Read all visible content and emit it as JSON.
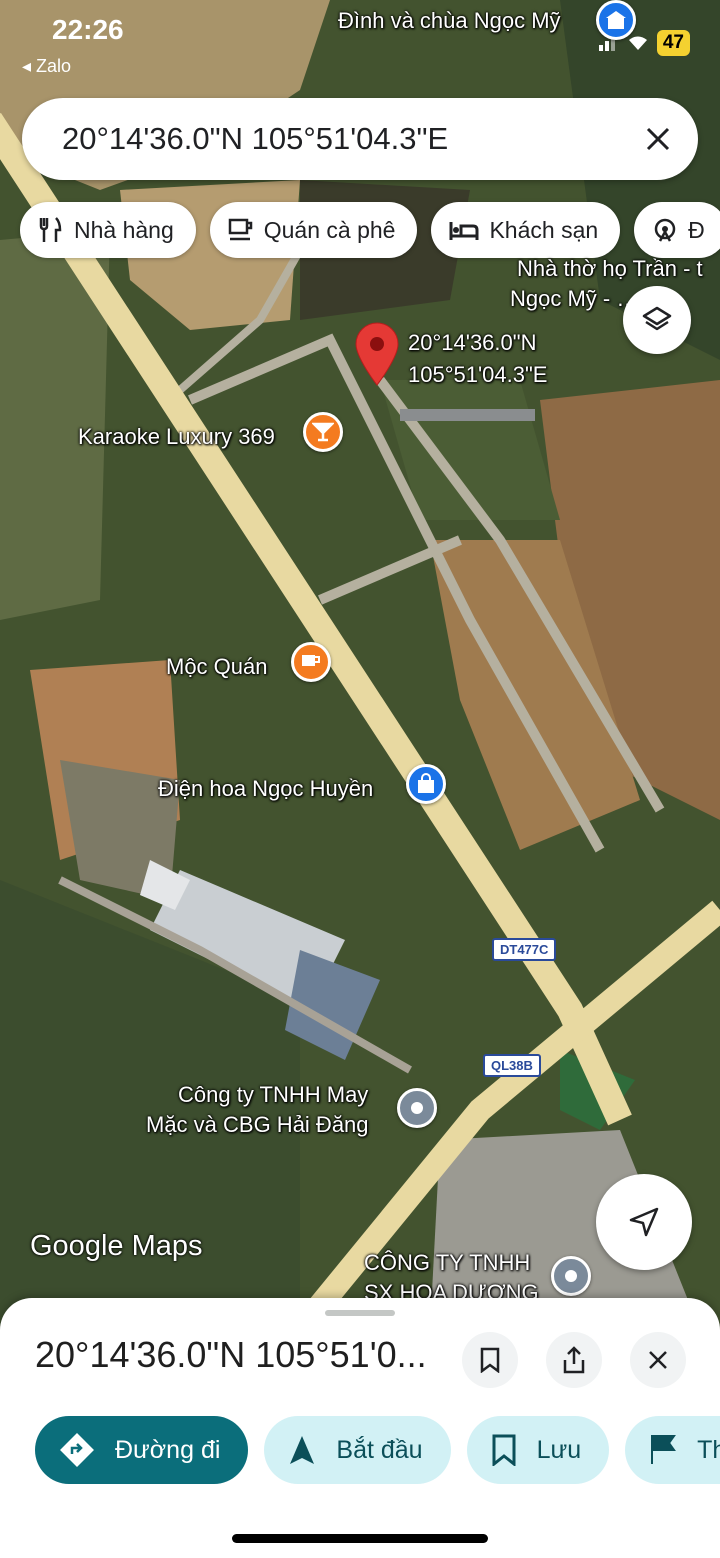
{
  "status": {
    "time": "22:26",
    "back_app": "Zalo",
    "battery": "47"
  },
  "search": {
    "query": "20°14'36.0\"N 105°51'04.3\"E"
  },
  "chips": [
    {
      "label": "Nhà hàng",
      "icon": "restaurant-icon"
    },
    {
      "label": "Quán cà phê",
      "icon": "cafe-icon"
    },
    {
      "label": "Khách sạn",
      "icon": "hotel-icon"
    },
    {
      "label": "Đ",
      "icon": "attraction-icon"
    }
  ],
  "map": {
    "pin_label_line1": "20°14'36.0\"N",
    "pin_label_line2": "105°51'04.3\"E",
    "labels": {
      "top_poi": "Đình và chùa Ngọc Mỹ",
      "nha_tho_1": "Nhà thờ họ Trần - t",
      "nha_tho_2": "Ngọc Mỹ - … húc",
      "karaoke": "Karaoke Luxury 369",
      "moc_quan": "Mộc Quán",
      "dien_hoa": "Điện hoa Ngọc Huyền",
      "cong_ty_may_1": "Công ty TNHH May",
      "cong_ty_may_2": "Mặc và CBG Hải Đăng",
      "cong_ty_sx_1": "CÔNG TY TNHH",
      "cong_ty_sx_2": "SX HOA DƯƠNG"
    },
    "roads": {
      "dt": "DT477C",
      "ql": "QL38B"
    },
    "brand": "Google Maps"
  },
  "sheet": {
    "title": "20°14'36.0\"N 105°51'0...",
    "actions": [
      {
        "label": "Đường đi",
        "icon": "directions-icon"
      },
      {
        "label": "Bắt đầu",
        "icon": "navigation-icon"
      },
      {
        "label": "Lưu",
        "icon": "bookmark-icon"
      },
      {
        "label": "Th",
        "icon": "flag-icon"
      }
    ]
  },
  "colors": {
    "accent": "#0b6e7b",
    "pin": "#e53935",
    "chip_tonal": "#d2f1f5"
  }
}
